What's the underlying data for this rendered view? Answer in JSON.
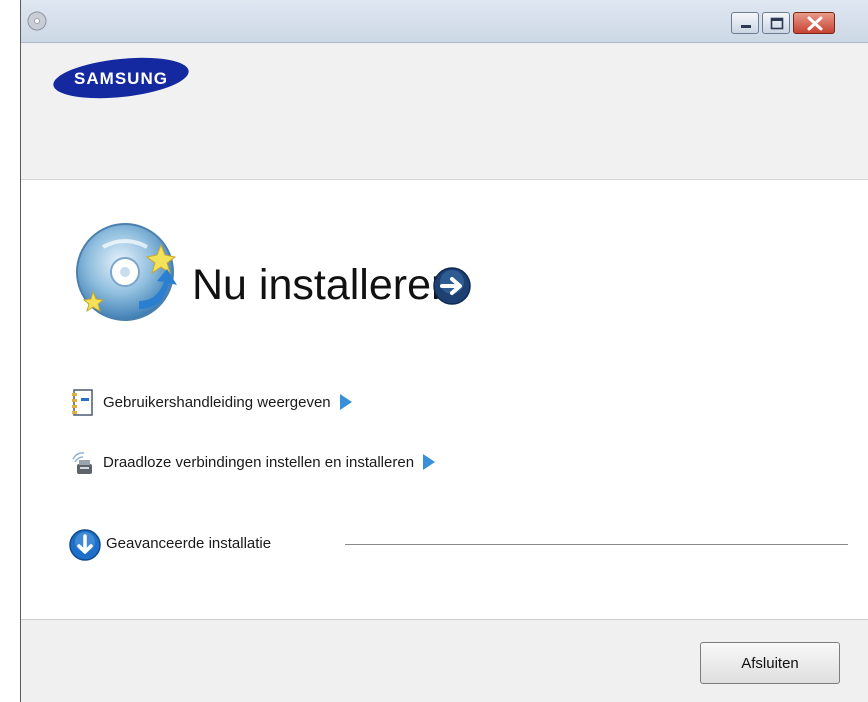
{
  "window": {
    "controls": [
      "minimize-icon",
      "maximize-icon",
      "close-icon"
    ],
    "title_color": "#cdd8e6"
  },
  "brand": {
    "logo_text": "SAMSUNG",
    "logo_color": "#1428a0"
  },
  "main": {
    "install_now": "Nu installeren",
    "links": [
      {
        "label": "Gebruikershandleiding weergeven",
        "icon": "manual-icon"
      },
      {
        "label": "Draadloze verbindingen instellen en installeren",
        "icon": "wireless-icon"
      }
    ],
    "advanced": {
      "label": "Geavanceerde installatie",
      "icon": "download-arrow-icon"
    }
  },
  "footer": {
    "exit_label": "Afsluiten"
  },
  "colors": {
    "accent_blue": "#1e6fc8",
    "arrow_blue": "#3a8fd9"
  }
}
